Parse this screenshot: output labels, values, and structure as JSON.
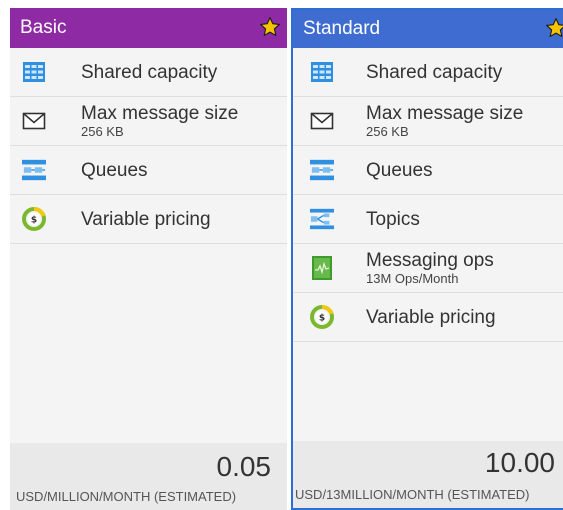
{
  "cards": [
    {
      "title": "Basic",
      "features": [
        {
          "icon": "shared-capacity-icon",
          "label": "Shared capacity",
          "sub": ""
        },
        {
          "icon": "envelope-icon",
          "label": "Max message size",
          "sub": "256 KB"
        },
        {
          "icon": "queues-icon",
          "label": "Queues",
          "sub": ""
        },
        {
          "icon": "variable-pricing-icon",
          "label": "Variable pricing",
          "sub": ""
        }
      ],
      "price": "0.05",
      "price_unit": "USD/MILLION/MONTH (ESTIMATED)"
    },
    {
      "title": "Standard",
      "features": [
        {
          "icon": "shared-capacity-icon",
          "label": "Shared capacity",
          "sub": ""
        },
        {
          "icon": "envelope-icon",
          "label": "Max message size",
          "sub": "256 KB"
        },
        {
          "icon": "queues-icon",
          "label": "Queues",
          "sub": ""
        },
        {
          "icon": "topics-icon",
          "label": "Topics",
          "sub": ""
        },
        {
          "icon": "messaging-ops-icon",
          "label": "Messaging ops",
          "sub": "13M Ops/Month"
        },
        {
          "icon": "variable-pricing-icon",
          "label": "Variable pricing",
          "sub": ""
        }
      ],
      "price": "10.00",
      "price_unit": "USD/13MILLION/MONTH (ESTIMATED)"
    }
  ],
  "colors": {
    "basic_header": "#8f2aa5",
    "standard_header": "#3f6cd1",
    "selected_border": "#2b6fd6",
    "star": "#f5c400"
  }
}
